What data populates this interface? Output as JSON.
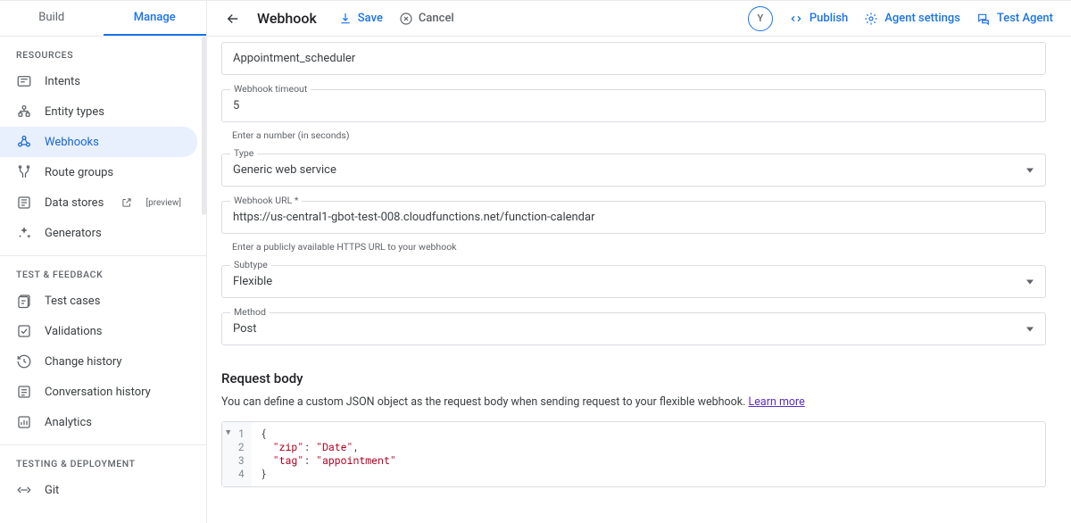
{
  "sidebar": {
    "tabs": {
      "build": "Build",
      "manage": "Manage",
      "active": "manage"
    },
    "sections": {
      "resources": {
        "label": "RESOURCES",
        "items": [
          {
            "id": "intents",
            "label": "Intents",
            "icon": "intent-icon"
          },
          {
            "id": "entity-types",
            "label": "Entity types",
            "icon": "entity-icon"
          },
          {
            "id": "webhooks",
            "label": "Webhooks",
            "icon": "webhook-icon",
            "active": true
          },
          {
            "id": "route-groups",
            "label": "Route groups",
            "icon": "route-icon"
          },
          {
            "id": "data-stores",
            "label": "Data stores",
            "icon": "datastore-icon",
            "external": true,
            "badge": "[preview]"
          },
          {
            "id": "generators",
            "label": "Generators",
            "icon": "generator-icon"
          }
        ]
      },
      "test_feedback": {
        "label": "TEST & FEEDBACK",
        "items": [
          {
            "id": "test-cases",
            "label": "Test cases",
            "icon": "testcases-icon"
          },
          {
            "id": "validations",
            "label": "Validations",
            "icon": "validations-icon"
          },
          {
            "id": "change-history",
            "label": "Change history",
            "icon": "history-icon"
          },
          {
            "id": "conversation-history",
            "label": "Conversation history",
            "icon": "conversation-icon"
          },
          {
            "id": "analytics",
            "label": "Analytics",
            "icon": "analytics-icon"
          }
        ]
      },
      "testing_deployment": {
        "label": "TESTING & DEPLOYMENT",
        "items": [
          {
            "id": "git",
            "label": "Git",
            "icon": "git-icon"
          }
        ]
      }
    }
  },
  "header": {
    "title": "Webhook",
    "save": "Save",
    "cancel": "Cancel",
    "avatar": "Y",
    "publish": "Publish",
    "agent_settings": "Agent settings",
    "test_agent": "Test Agent"
  },
  "form": {
    "name": {
      "value": "Appointment_scheduler"
    },
    "timeout": {
      "label": "Webhook timeout",
      "value": "5",
      "hint": "Enter a number (in seconds)"
    },
    "type": {
      "label": "Type",
      "value": "Generic web service"
    },
    "url": {
      "label": "Webhook URL *",
      "value": "https://us-central1-gbot-test-008.cloudfunctions.net/function-calendar",
      "hint": "Enter a publicly available HTTPS URL to your webhook"
    },
    "subtype": {
      "label": "Subtype",
      "value": "Flexible"
    },
    "method": {
      "label": "Method",
      "value": "Post"
    },
    "request_body": {
      "title": "Request body",
      "desc_text": "You can define a custom JSON object as the request body when sending request to your flexible webhook. ",
      "learn_more": "Learn more",
      "json": {
        "lines": [
          "1",
          "2",
          "3",
          "4"
        ],
        "content": [
          {
            "type": "punc",
            "text": "{"
          },
          {
            "type": "line",
            "indent": 1,
            "key": "\"zip\"",
            "val": "\"Date\"",
            "comma": true
          },
          {
            "type": "line",
            "indent": 1,
            "key": "\"tag\"",
            "val": "\"appointment\"",
            "comma": false
          },
          {
            "type": "punc",
            "text": "}"
          }
        ]
      }
    }
  }
}
